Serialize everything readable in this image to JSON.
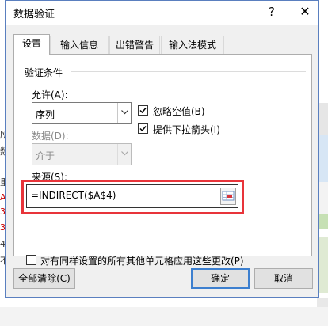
{
  "window": {
    "title": "数据验证",
    "help_glyph": "?",
    "close_glyph": "✕"
  },
  "tabs": [
    {
      "label": "设置",
      "active": true
    },
    {
      "label": "输入信息",
      "active": false
    },
    {
      "label": "出错警告",
      "active": false
    },
    {
      "label": "输入法模式",
      "active": false
    }
  ],
  "settings": {
    "group_title": "验证条件",
    "allow": {
      "label": "允许(A):",
      "value": "序列"
    },
    "data": {
      "label": "数据(D):",
      "value": "介于",
      "disabled": true
    },
    "ignore_blank": {
      "label": "忽略空值(B)",
      "checked": true
    },
    "dropdown_arrow": {
      "label": "提供下拉箭头(I)",
      "checked": true
    },
    "source": {
      "label": "来源(S):",
      "value": "=INDIRECT($A$4)"
    }
  },
  "apply_all": {
    "label": "对有同样设置的所有其他单元格应用这些更改(P)",
    "checked": false
  },
  "buttons": {
    "clear_all": "全部清除(C)",
    "ok": "确定",
    "cancel": "取消"
  },
  "background": {
    "left_fragments": [
      "所",
      "数",
      "",
      "重",
      "A4",
      "34",
      "34",
      "4",
      "不"
    ]
  },
  "colors": {
    "highlight": "#e8343a",
    "dialog_border": "#5a7fbf",
    "default_button": "#3c7fcf"
  }
}
